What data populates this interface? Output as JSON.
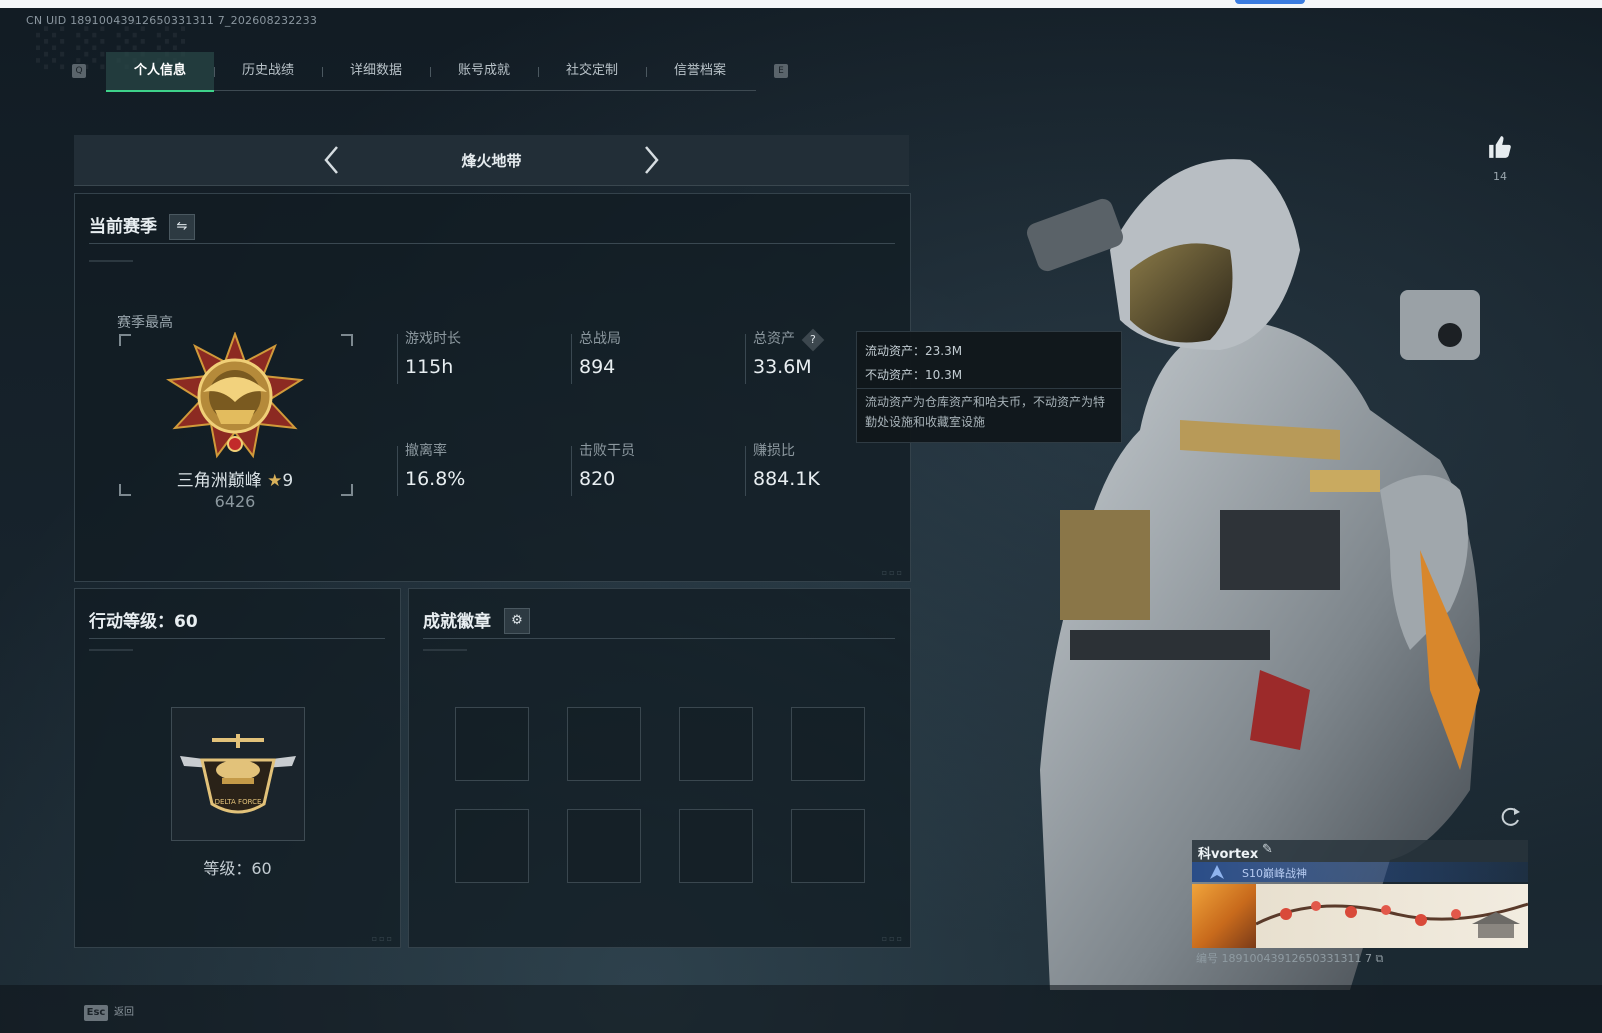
{
  "uid_line": "CN UID 18910043912650331311 7_202608232233",
  "tabs": {
    "left_key": "Q",
    "right_key": "E",
    "items": [
      "个人信息",
      "历史战绩",
      "详细数据",
      "账号成就",
      "社交定制",
      "信誉档案"
    ],
    "active_index": 0
  },
  "mode": {
    "title": "烽火地带"
  },
  "season_panel": {
    "title": "当前赛季",
    "season_best_label": "赛季最高",
    "rank_name": "三角洲巅峰",
    "rank_stars": "9",
    "rank_score": "6426",
    "stats": [
      {
        "label": "游戏时长",
        "value": "115h"
      },
      {
        "label": "总战局",
        "value": "894"
      },
      {
        "label": "总资产",
        "value": "33.6M"
      },
      {
        "label": "撤离率",
        "value": "16.8%"
      },
      {
        "label": "击败干员",
        "value": "820"
      },
      {
        "label": "赚损比",
        "value": "884.1K"
      }
    ],
    "help_icon": "?"
  },
  "tooltip": {
    "liquid": "流动资产：23.3M",
    "fixed": "不动资产：10.3M",
    "note": "流动资产为仓库资产和哈夫币，不动资产为特勤处设施和收藏室设施"
  },
  "level_panel": {
    "title": "行动等级：60",
    "level_text": "等级：60",
    "emblem_text": "DELTA FORCE"
  },
  "badges_panel": {
    "title": "成就徽章",
    "slots": 8
  },
  "like": {
    "count": "14"
  },
  "namecard": {
    "name": "vortex",
    "name_prefix": "科",
    "title": "S10巅峰战神",
    "id_line": "编号 18910043912650331311 7"
  },
  "esc": {
    "key": "Esc",
    "label": "返回"
  },
  "colors": {
    "accent_green": "#3ed28a",
    "panel_bg": "#121c23",
    "title_bar_blue": "#2a4d88"
  }
}
